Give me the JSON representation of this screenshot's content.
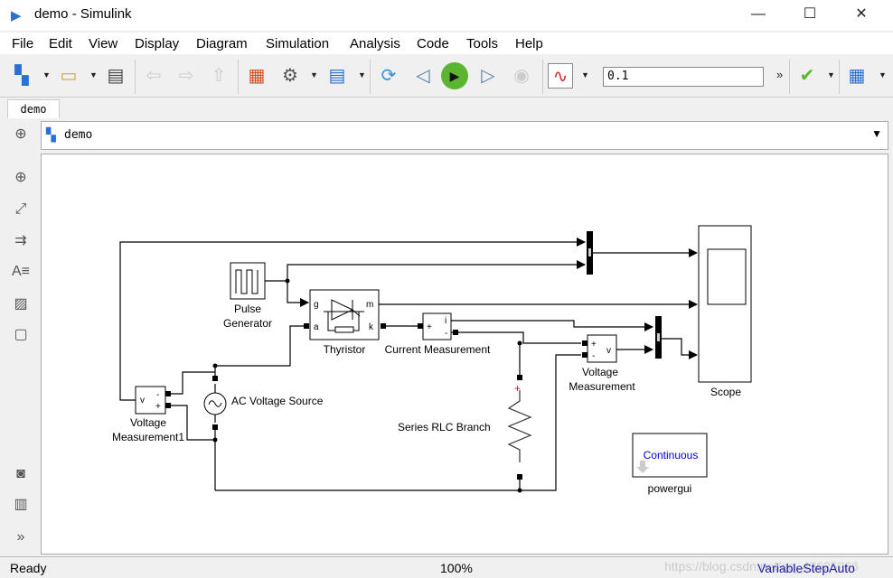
{
  "window": {
    "title": "demo - Simulink",
    "minimize": "—",
    "maximize": "☐",
    "close": "✕"
  },
  "menu": [
    "File",
    "Edit",
    "View",
    "Display",
    "Diagram",
    "Simulation",
    "Analysis",
    "Code",
    "Tools",
    "Help"
  ],
  "toolbar": {
    "stop_time": "0.1",
    "overflow": "»"
  },
  "tab": "demo",
  "address": "demo",
  "blocks": {
    "pulse": "Pulse",
    "pulse2": "Generator",
    "thyristor": "Thyristor",
    "g": "g",
    "a": "a",
    "m": "m",
    "k": "k",
    "current": "Current Measurement",
    "plus": "+",
    "minus": "-",
    "i": "i",
    "v": "v",
    "vm1a": "Voltage",
    "vm1b": "Measurement1",
    "vma": "Voltage",
    "vmb": "Measurement",
    "ac": "AC Voltage Source",
    "rlc": "Series RLC Branch",
    "scope": "Scope",
    "powergui": "powergui",
    "continuous": "Continuous"
  },
  "status": {
    "left": "Ready",
    "zoom": "100%",
    "solver": "VariableStepAuto",
    "watermark": "https://blog.csdn.net/qq_43625266"
  }
}
